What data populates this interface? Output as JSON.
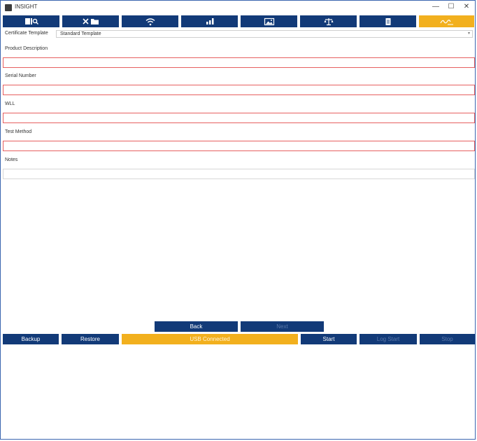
{
  "window": {
    "title": "INSIGHT",
    "controls": {
      "minimize": "—",
      "maximize": "☐",
      "close": "✕"
    }
  },
  "tabs": [
    {
      "icon": "database-search-icon",
      "active": false
    },
    {
      "icon": "tools-folder-icon",
      "active": false
    },
    {
      "icon": "wifi-icon",
      "active": false
    },
    {
      "icon": "bar-chart-icon",
      "active": false
    },
    {
      "icon": "image-icon",
      "active": false
    },
    {
      "icon": "balance-scale-icon",
      "active": false
    },
    {
      "icon": "document-icon",
      "active": false
    },
    {
      "icon": "signature-icon",
      "active": true
    }
  ],
  "certificate_template": {
    "label": "Certificate Template",
    "selected": "Standard Template"
  },
  "fields": [
    {
      "label": "Product Description",
      "value": "",
      "required": true
    },
    {
      "label": "Serial Number",
      "value": "",
      "required": true
    },
    {
      "label": "WLL",
      "value": "",
      "required": true
    },
    {
      "label": "Test Method",
      "value": "",
      "required": true
    },
    {
      "label": "Notes",
      "value": "",
      "required": false
    }
  ],
  "nav_buttons": {
    "back": "Back",
    "next": "Next"
  },
  "bottom_bar": {
    "backup": "Backup",
    "restore": "Restore",
    "status": "USB Connected",
    "start": "Start",
    "log_start": "Log Start",
    "stop": "Stop"
  },
  "colors": {
    "primary": "#123a78",
    "accent": "#f2b01e",
    "required_border": "#e76060",
    "window_border": "#3a66b0"
  }
}
